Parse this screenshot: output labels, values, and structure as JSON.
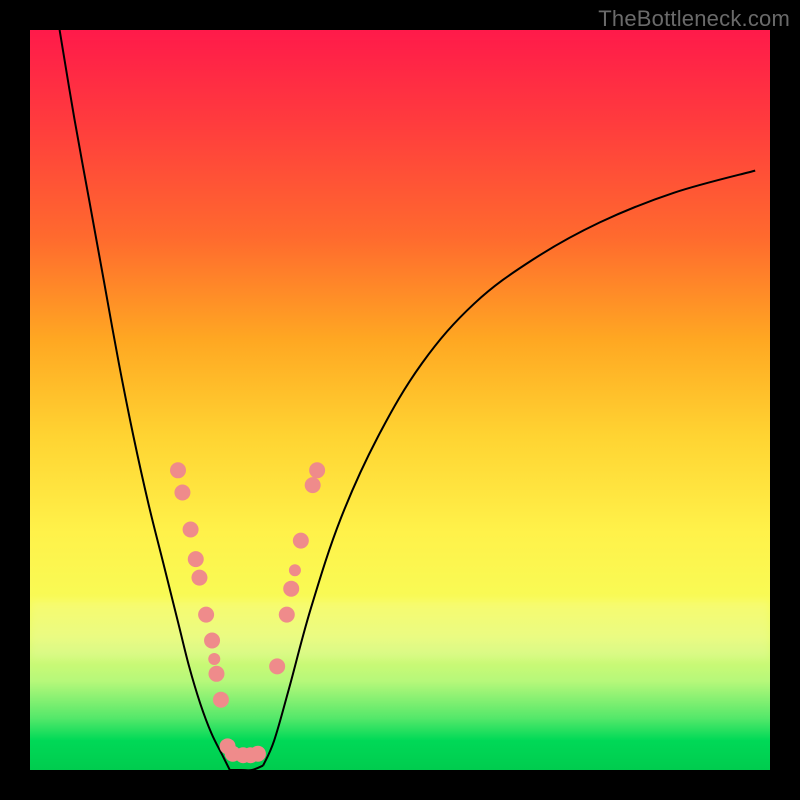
{
  "watermark": "TheBottleneck.com",
  "colors": {
    "frame": "#000000",
    "gradient_top": "#ff1a4a",
    "gradient_bottom": "#00cc4e",
    "curve": "#000000",
    "dot": "#ef8b8b"
  },
  "chart_data": {
    "type": "line",
    "title": "",
    "xlabel": "",
    "ylabel": "",
    "xlim": [
      0,
      100
    ],
    "ylim": [
      0,
      100
    ],
    "grid": false,
    "series": [
      {
        "name": "curve-left",
        "x": [
          4,
          6,
          8,
          10,
          12,
          14,
          16,
          18,
          20,
          21.5,
          23,
          24.5,
          26,
          27
        ],
        "y": [
          100,
          88,
          77,
          66,
          55,
          45,
          36,
          28,
          20,
          14,
          9,
          5,
          2,
          0
        ]
      },
      {
        "name": "bottom-segment",
        "x": [
          27,
          28.5,
          30,
          31.5
        ],
        "y": [
          0,
          0,
          0,
          0.6
        ]
      },
      {
        "name": "curve-right",
        "x": [
          31.5,
          33,
          35,
          38,
          42,
          47,
          53,
          60,
          68,
          77,
          87,
          98
        ],
        "y": [
          0.6,
          4,
          11,
          22,
          34,
          45,
          55,
          63,
          69,
          74,
          78,
          81
        ]
      }
    ],
    "points": [
      {
        "name": "left",
        "x": 20.0,
        "y": 40.5,
        "r": 8
      },
      {
        "name": "left",
        "x": 20.6,
        "y": 37.5,
        "r": 8
      },
      {
        "name": "left",
        "x": 21.7,
        "y": 32.5,
        "r": 8
      },
      {
        "name": "left",
        "x": 22.4,
        "y": 28.5,
        "r": 8
      },
      {
        "name": "left",
        "x": 22.9,
        "y": 26.0,
        "r": 8
      },
      {
        "name": "left",
        "x": 23.8,
        "y": 21.0,
        "r": 8
      },
      {
        "name": "left",
        "x": 24.6,
        "y": 17.5,
        "r": 8
      },
      {
        "name": "left",
        "x": 24.9,
        "y": 15.0,
        "r": 6
      },
      {
        "name": "left",
        "x": 25.2,
        "y": 13.0,
        "r": 8
      },
      {
        "name": "left",
        "x": 25.8,
        "y": 9.5,
        "r": 8
      },
      {
        "name": "bottom",
        "x": 26.7,
        "y": 3.2,
        "r": 8
      },
      {
        "name": "bottom",
        "x": 27.4,
        "y": 2.2,
        "r": 8
      },
      {
        "name": "bottom",
        "x": 28.8,
        "y": 2.0,
        "r": 8
      },
      {
        "name": "bottom",
        "x": 29.8,
        "y": 2.0,
        "r": 8
      },
      {
        "name": "bottom",
        "x": 30.8,
        "y": 2.2,
        "r": 8
      },
      {
        "name": "right",
        "x": 33.4,
        "y": 14.0,
        "r": 8
      },
      {
        "name": "right",
        "x": 34.7,
        "y": 21.0,
        "r": 8
      },
      {
        "name": "right",
        "x": 35.3,
        "y": 24.5,
        "r": 8
      },
      {
        "name": "right",
        "x": 35.8,
        "y": 27.0,
        "r": 6
      },
      {
        "name": "right",
        "x": 36.6,
        "y": 31.0,
        "r": 8
      },
      {
        "name": "right",
        "x": 38.2,
        "y": 38.5,
        "r": 8
      },
      {
        "name": "right",
        "x": 38.8,
        "y": 40.5,
        "r": 8
      }
    ]
  }
}
